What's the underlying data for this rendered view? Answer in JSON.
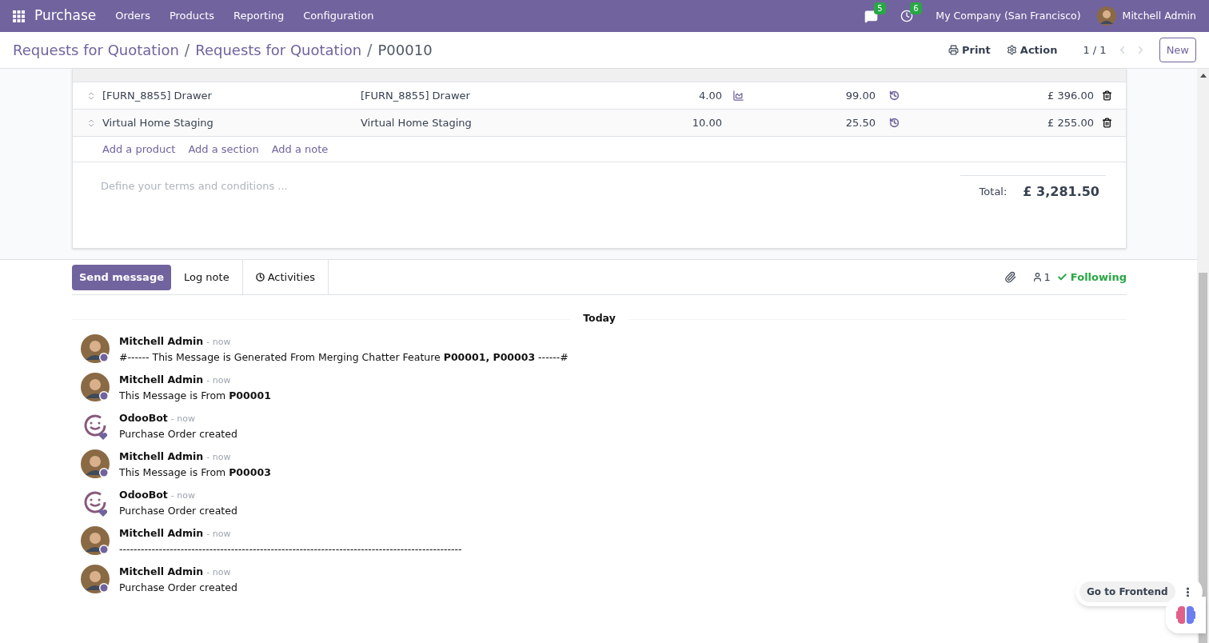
{
  "navbar": {
    "app": "Purchase",
    "menu": [
      "Orders",
      "Products",
      "Reporting",
      "Configuration"
    ],
    "messages_count": "5",
    "activities_count": "6",
    "company": "My Company (San Francisco)",
    "user": "Mitchell Admin"
  },
  "breadcrumb_separator": "/",
  "breadcrumbs": [
    {
      "label": "Requests for Quotation",
      "current": false
    },
    {
      "label": "Requests for Quotation",
      "current": false
    },
    {
      "label": "P00010",
      "current": true
    }
  ],
  "control_panel": {
    "print": "Print",
    "action": "Action",
    "pager": "1 / 1",
    "new": "New"
  },
  "lines": [
    {
      "product": "[FURN_8855] Drawer",
      "description": "[FURN_8855] Drawer",
      "quantity": "4.00",
      "forecast_icon": true,
      "unit_price": "99.00",
      "subtotal": "£ 396.00"
    },
    {
      "product": "Virtual Home Staging",
      "description": "Virtual Home Staging",
      "quantity": "10.00",
      "forecast_icon": false,
      "unit_price": "25.50",
      "subtotal": "£ 255.00"
    }
  ],
  "add_links": [
    "Add a product",
    "Add a section",
    "Add a note"
  ],
  "terms": {
    "placeholder": "Define your terms and conditions ..."
  },
  "total": {
    "label": "Total:",
    "value": "£ 3,281.50"
  },
  "chatter": {
    "buttons": [
      {
        "label": "Send message",
        "kind": "primary"
      },
      {
        "label": "Log note",
        "kind": "tab"
      },
      {
        "label": "Activities",
        "kind": "activity"
      }
    ],
    "followers": "1",
    "following": "Following",
    "date_separator": "Today",
    "messages": [
      {
        "author": "Mitchell Admin",
        "kind": "user",
        "time": "- now",
        "body": "#------ This Message is Generated From Merging Chatter Feature **P00001, P00003** ------#"
      },
      {
        "author": "Mitchell Admin",
        "kind": "user",
        "time": "- now",
        "body": "This Message is From **P00001**"
      },
      {
        "author": "OdooBot",
        "kind": "bot",
        "time": "- now",
        "body": "Purchase Order created"
      },
      {
        "author": "Mitchell Admin",
        "kind": "user",
        "time": "- now",
        "body": "This Message is From **P00003**"
      },
      {
        "author": "OdooBot",
        "kind": "bot",
        "time": "- now",
        "body": "Purchase Order created"
      },
      {
        "author": "Mitchell Admin",
        "kind": "user",
        "time": "- now",
        "body": "-----------------------------------------------------------------------------------------------"
      },
      {
        "author": "Mitchell Admin",
        "kind": "user",
        "time": "- now",
        "body": "Purchase Order created"
      }
    ]
  },
  "frontend_button": "Go to Frontend"
}
